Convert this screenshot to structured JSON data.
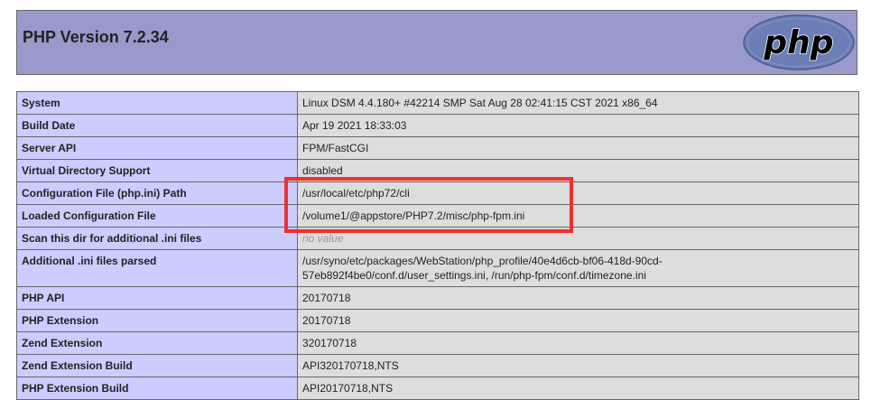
{
  "header": {
    "title": "PHP Version 7.2.34",
    "logo_text": "php"
  },
  "colors": {
    "header_bg": "#9999cc",
    "label_bg": "#ccccff",
    "value_bg": "#dddddd",
    "highlight": "#ee3030"
  },
  "rows": [
    {
      "label": "System",
      "value": "Linux DSM 4.4.180+ #42214 SMP Sat Aug 28 02:41:15 CST 2021 x86_64"
    },
    {
      "label": "Build Date",
      "value": "Apr 19 2021 18:33:03"
    },
    {
      "label": "Server API",
      "value": "FPM/FastCGI"
    },
    {
      "label": "Virtual Directory Support",
      "value": "disabled"
    },
    {
      "label": "Configuration File (php.ini) Path",
      "value": "/usr/local/etc/php72/cli"
    },
    {
      "label": "Loaded Configuration File",
      "value": "/volume1/@appstore/PHP7.2/misc/php-fpm.ini"
    },
    {
      "label": "Scan this dir for additional .ini files",
      "value": "no value"
    },
    {
      "label": "Additional .ini files parsed",
      "value_line1": "/usr/syno/etc/packages/WebStation/php_profile/40e4d6cb-bf06-418d-90cd-",
      "value_line2": "57eb892f4be0/conf.d/user_settings.ini, /run/php-fpm/conf.d/timezone.ini"
    },
    {
      "label": "PHP API",
      "value": "20170718"
    },
    {
      "label": "PHP Extension",
      "value": "20170718"
    },
    {
      "label": "Zend Extension",
      "value": "320170718"
    },
    {
      "label": "Zend Extension Build",
      "value": "API320170718,NTS"
    },
    {
      "label": "PHP Extension Build",
      "value": "API20170718,NTS"
    }
  ]
}
